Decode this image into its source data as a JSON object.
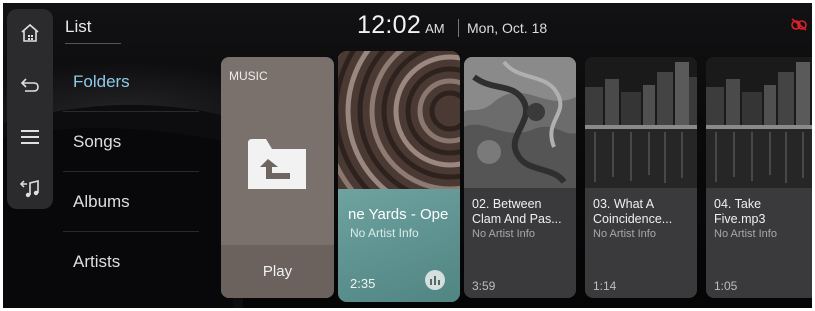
{
  "header": {
    "title": "List",
    "time": "12:02",
    "ampm": "AM",
    "date": "Mon, Oct. 18"
  },
  "rail": {
    "icons": [
      "home-icon",
      "back-icon",
      "menu-icon",
      "music-source-icon"
    ]
  },
  "categories": [
    {
      "label": "Folders",
      "active": true
    },
    {
      "label": "Songs",
      "active": false
    },
    {
      "label": "Albums",
      "active": false
    },
    {
      "label": "Artists",
      "active": false
    }
  ],
  "folder_card": {
    "label": "MUSIC",
    "play_label": "Play",
    "icon": "folder-up-icon"
  },
  "now_playing": {
    "title": "ne Yards - Ope",
    "artist": "No Artist Info",
    "time": "2:35",
    "icon": "equalizer-icon"
  },
  "tracks": [
    {
      "title": "02. Between Clam And Pas...",
      "artist": "No Artist Info",
      "time": "3:59"
    },
    {
      "title": "03. What A Coincidence...",
      "artist": "No Artist Info",
      "time": "1:14"
    },
    {
      "title": "04. Take Five.mp3",
      "artist": "No Artist Info",
      "time": "1:05"
    }
  ],
  "colors": {
    "accent": "#8ecbe8",
    "status_red": "#e0202a",
    "now_playing_teal": "#5f9391"
  }
}
